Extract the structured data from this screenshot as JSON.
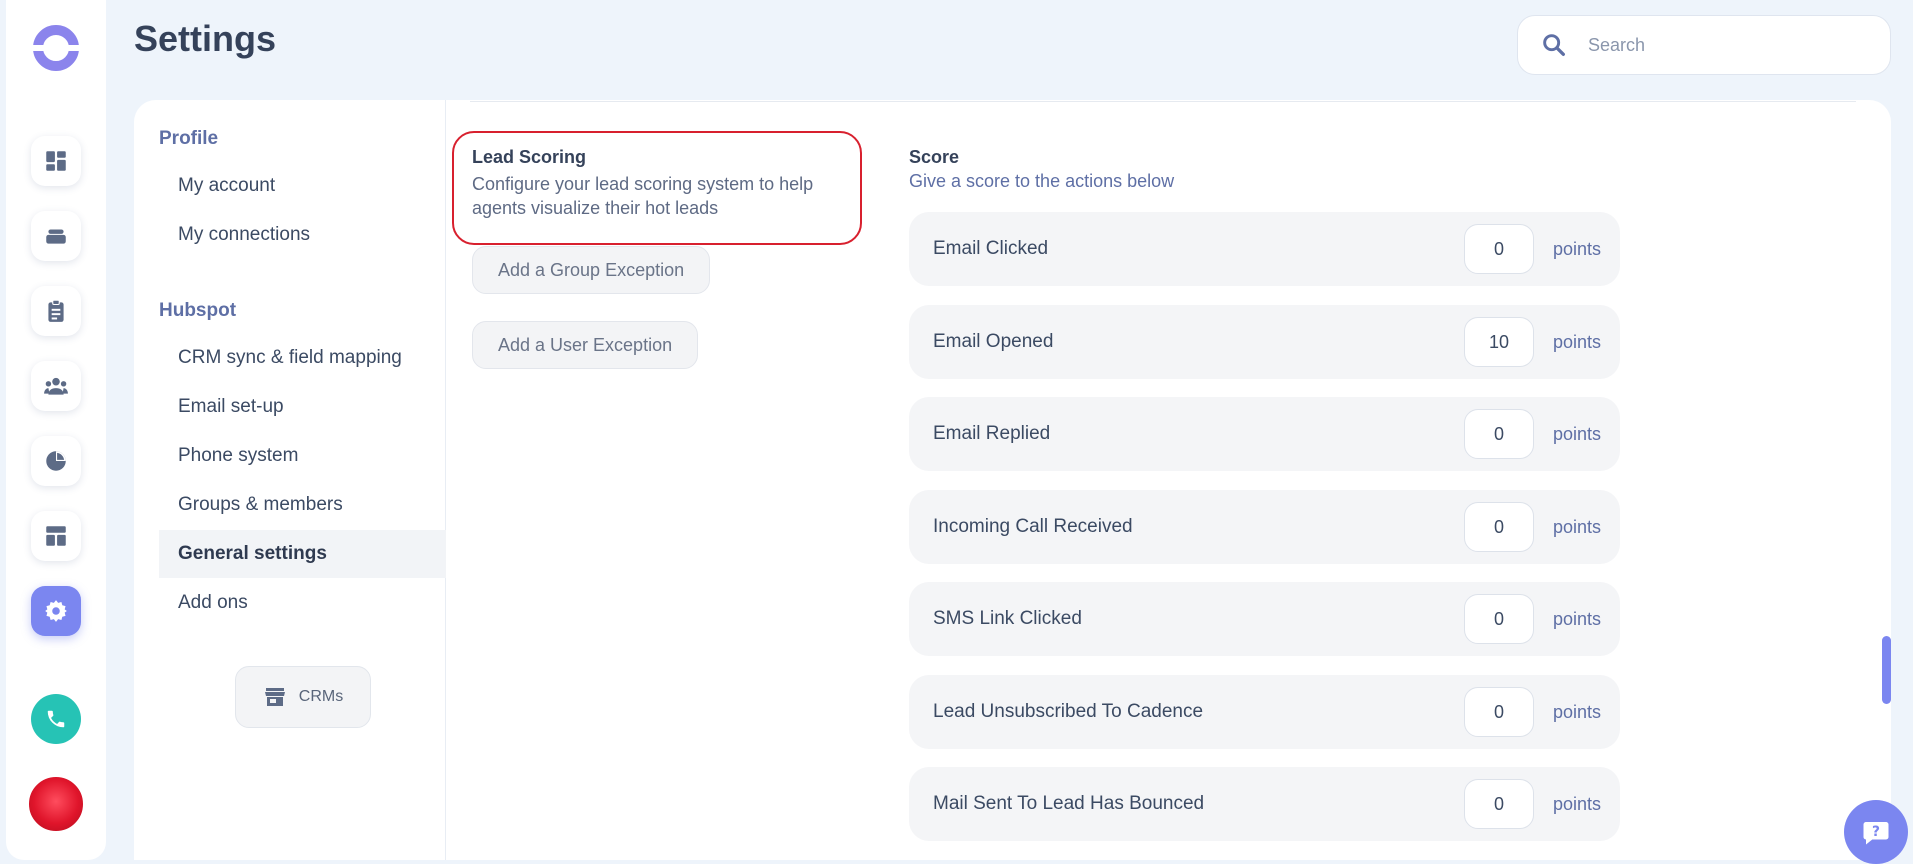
{
  "header": {
    "title": "Settings"
  },
  "search": {
    "placeholder": "Search",
    "value": ""
  },
  "rail": {
    "items": [
      {
        "icon": "dashboard-icon"
      },
      {
        "icon": "inbox-tray-icon"
      },
      {
        "icon": "clipboard-icon"
      },
      {
        "icon": "people-icon"
      },
      {
        "icon": "pie-chart-icon"
      },
      {
        "icon": "layout-icon"
      },
      {
        "icon": "gear-icon",
        "active": true
      }
    ],
    "phone_icon": "phone-icon"
  },
  "subnav": {
    "groups": [
      {
        "label": "Profile",
        "items": [
          "My account",
          "My connections"
        ]
      },
      {
        "label": "Hubspot",
        "items": [
          "CRM sync & field mapping",
          "Email set-up",
          "Phone system",
          "Groups & members",
          "General settings",
          "Add ons"
        ]
      }
    ],
    "active_item": "General settings",
    "crms_label": "CRMs"
  },
  "lead_scoring": {
    "title": "Lead Scoring",
    "description": "Configure your lead scoring system to help agents visualize their hot leads",
    "group_exception_label": "Add a Group Exception",
    "user_exception_label": "Add a User Exception"
  },
  "score": {
    "title": "Score",
    "subtitle": "Give a score to the actions below",
    "unit": "points",
    "rows": [
      {
        "label": "Email Clicked",
        "value": "0"
      },
      {
        "label": "Email Opened",
        "value": "10"
      },
      {
        "label": "Email Replied",
        "value": "0"
      },
      {
        "label": "Incoming Call Received",
        "value": "0"
      },
      {
        "label": "SMS Link Clicked",
        "value": "0"
      },
      {
        "label": "Lead Unsubscribed To Cadence",
        "value": "0"
      },
      {
        "label": "Mail Sent To Lead Has Bounced",
        "value": "0"
      }
    ]
  },
  "colors": {
    "accent": "#7b86f0",
    "highlight_border": "#d8202e",
    "phone": "#26c3b5",
    "background": "#eef4fb"
  }
}
